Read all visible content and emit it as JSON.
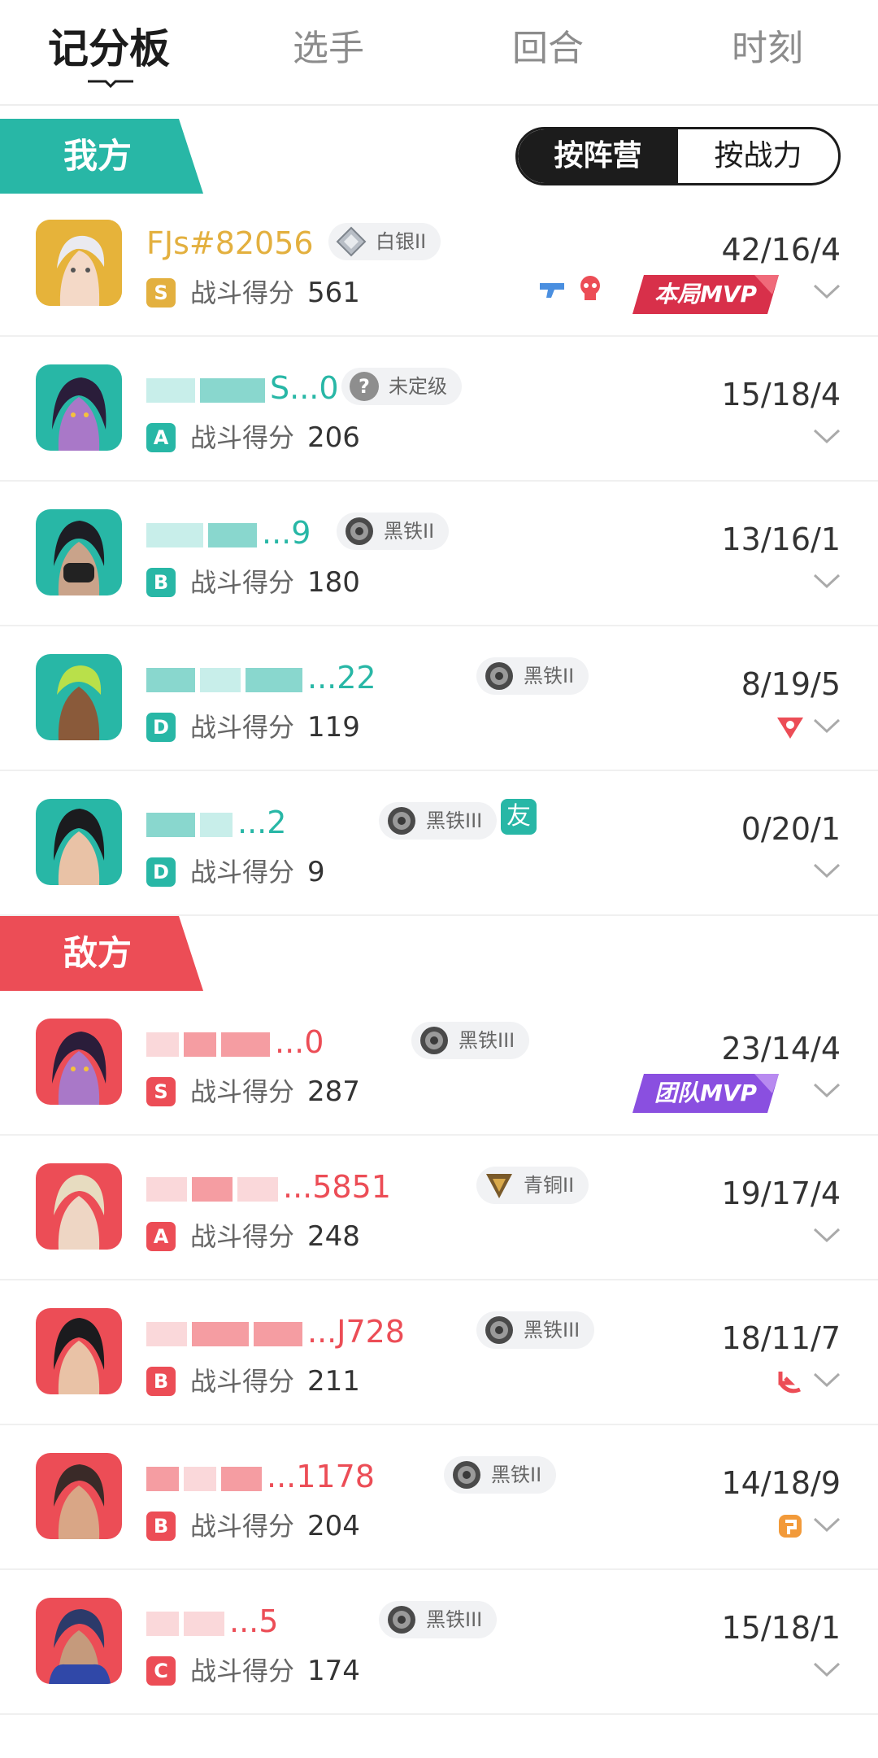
{
  "tabs": [
    "记分板",
    "选手",
    "回合",
    "时刻"
  ],
  "ally": {
    "label": "我方",
    "sort_options": [
      "按阵营",
      "按战力"
    ],
    "players": [
      {
        "name": "FJs#82056",
        "rank": "白银II",
        "grade": "S",
        "score_label": "战斗得分",
        "score": "561",
        "kda": "42/16/4",
        "mvp": "本局MVP"
      },
      {
        "name": "S...0",
        "rank": "未定级",
        "grade": "A",
        "score_label": "战斗得分",
        "score": "206",
        "kda": "15/18/4"
      },
      {
        "name": "...9",
        "rank": "黑铁II",
        "grade": "B",
        "score_label": "战斗得分",
        "score": "180",
        "kda": "13/16/1"
      },
      {
        "name": "...22",
        "rank": "黑铁II",
        "grade": "D",
        "score_label": "战斗得分",
        "score": "119",
        "kda": "8/19/5"
      },
      {
        "name": "...2",
        "rank": "黑铁III",
        "grade": "D",
        "score_label": "战斗得分",
        "score": "9",
        "kda": "0/20/1",
        "friend": "友"
      }
    ]
  },
  "enemy": {
    "label": "敌方",
    "players": [
      {
        "name": "...0",
        "rank": "黑铁III",
        "grade": "S",
        "score_label": "战斗得分",
        "score": "287",
        "kda": "23/14/4",
        "mvp": "团队MVP"
      },
      {
        "name": "...5851",
        "rank": "青铜II",
        "grade": "A",
        "score_label": "战斗得分",
        "score": "248",
        "kda": "19/17/4"
      },
      {
        "name": "...J728",
        "rank": "黑铁III",
        "grade": "B",
        "score_label": "战斗得分",
        "score": "211",
        "kda": "18/11/7"
      },
      {
        "name": "...1178",
        "rank": "黑铁II",
        "grade": "B",
        "score_label": "战斗得分",
        "score": "204",
        "kda": "14/18/9"
      },
      {
        "name": "...5",
        "rank": "黑铁III",
        "grade": "C",
        "score_label": "战斗得分",
        "score": "174",
        "kda": "15/18/1"
      }
    ]
  },
  "colors": {
    "ally": "#28b7a6",
    "enemy": "#ec4d56",
    "gold": "#e3b03f",
    "purple": "#8a4fe0"
  }
}
